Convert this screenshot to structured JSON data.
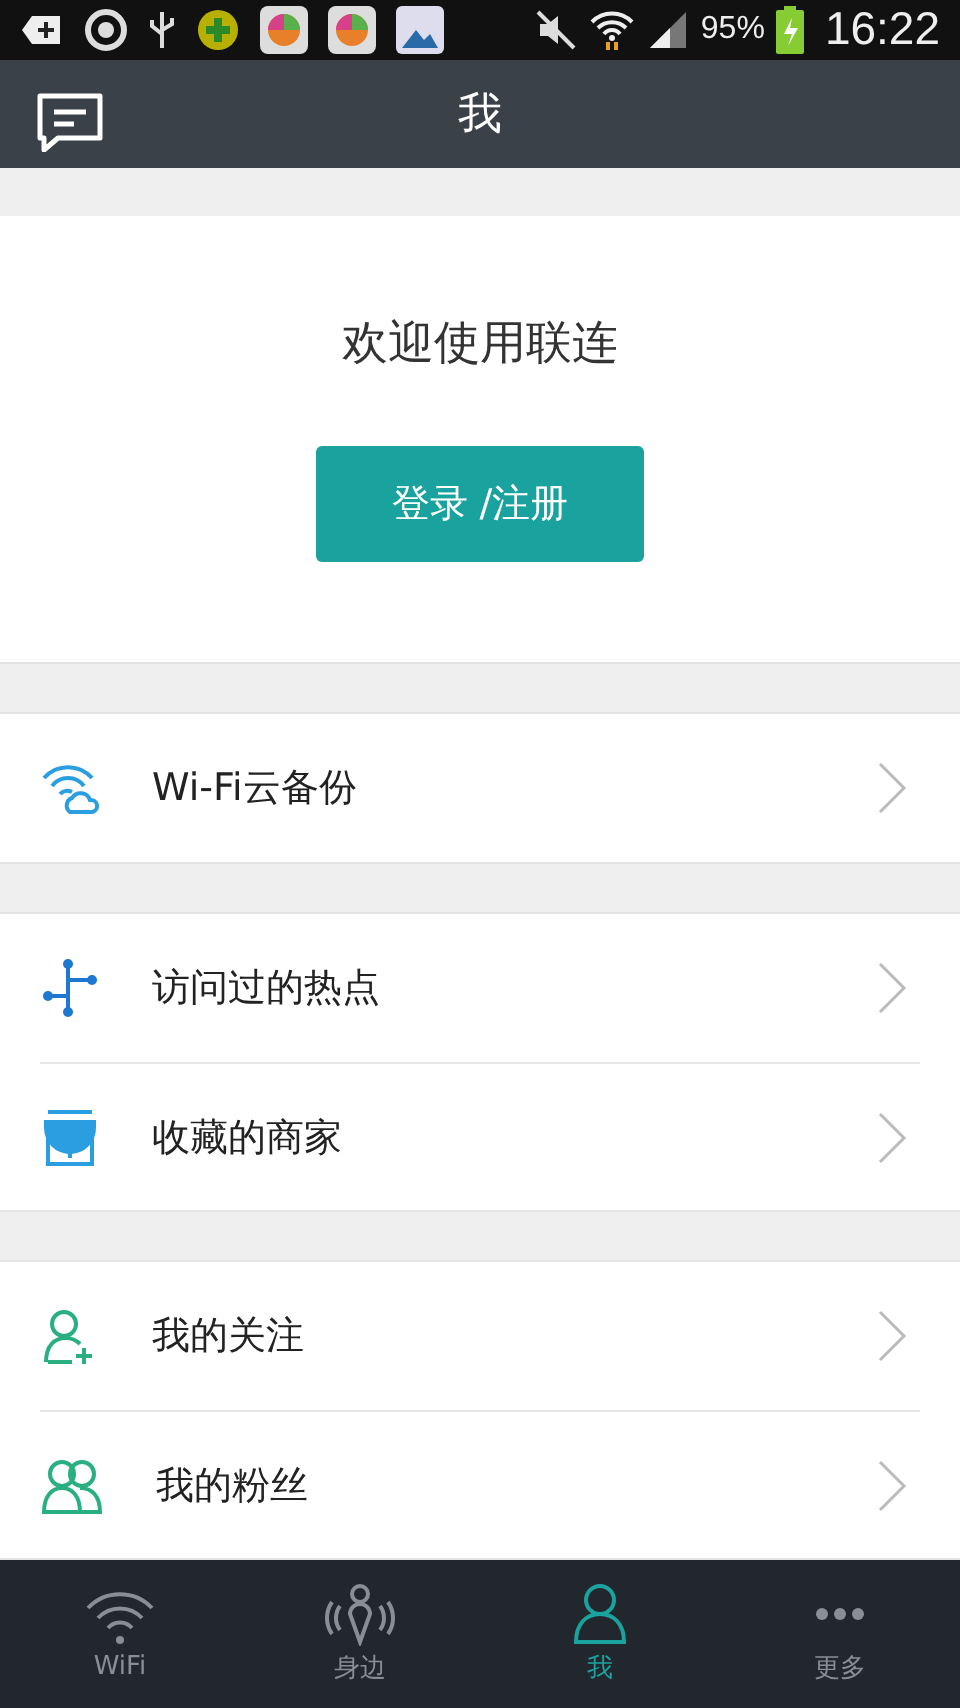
{
  "status_bar": {
    "battery": "95%",
    "time": "16:22"
  },
  "header": {
    "title": "我"
  },
  "welcome": {
    "text": "欢迎使用联连",
    "button": "登录 /注册"
  },
  "groups": [
    {
      "items": [
        {
          "kind": "wifi-cloud",
          "label": "Wi-Fi云备份"
        }
      ]
    },
    {
      "items": [
        {
          "kind": "hotspot",
          "label": "访问过的热点"
        },
        {
          "kind": "shop",
          "label": "收藏的商家"
        }
      ]
    },
    {
      "items": [
        {
          "kind": "follow",
          "label": "我的关注"
        },
        {
          "kind": "fans",
          "label": "我的粉丝"
        }
      ]
    }
  ],
  "tabs": [
    {
      "kind": "wifi",
      "label": "WiFi",
      "selected": false
    },
    {
      "kind": "nearby",
      "label": "身边",
      "selected": false
    },
    {
      "kind": "me",
      "label": "我",
      "selected": true
    },
    {
      "kind": "more",
      "label": "更多",
      "selected": false
    }
  ]
}
